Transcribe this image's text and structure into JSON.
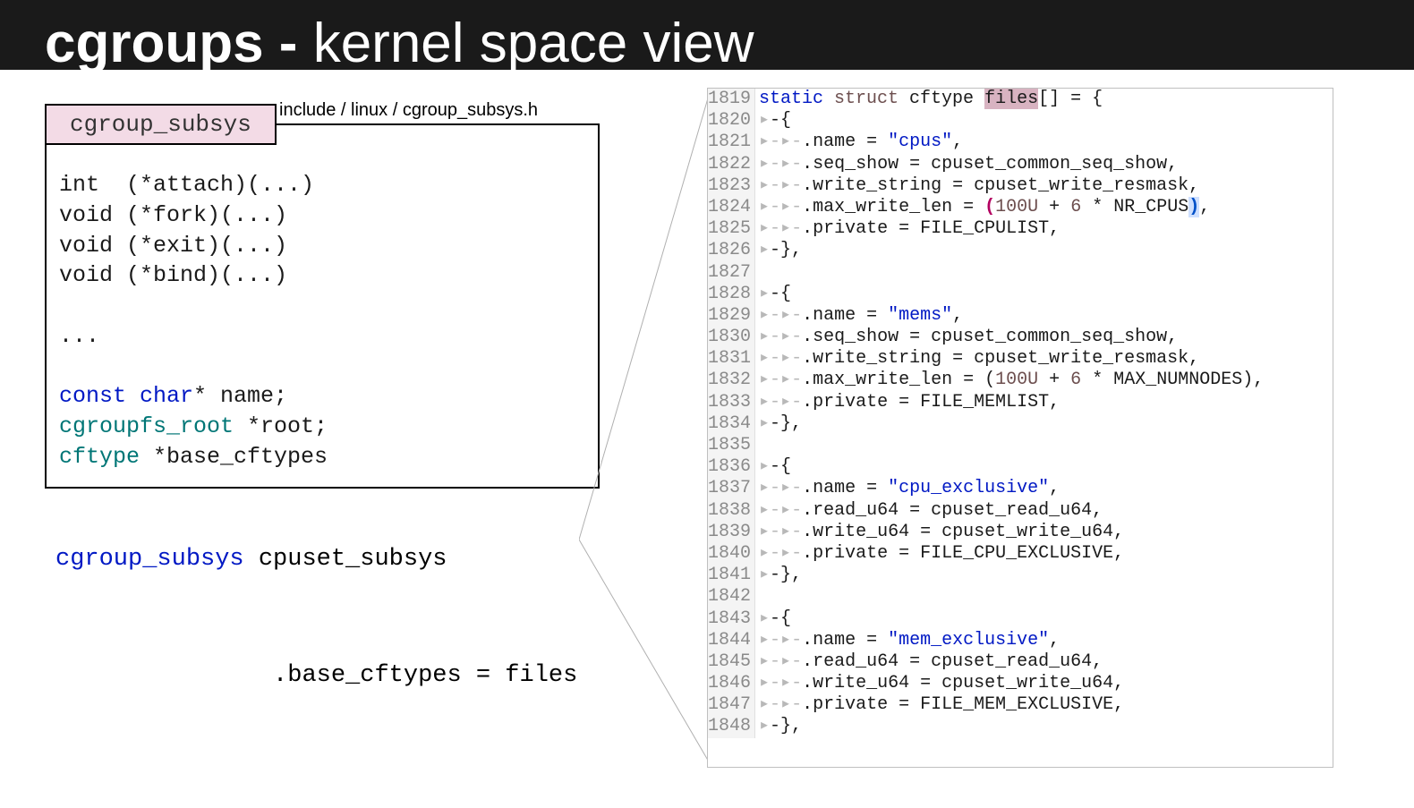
{
  "title_bold": "cgroups - ",
  "title_thin": "kernel space view",
  "header_path": "include / linux / cgroup_subsys.h",
  "tag": "cgroup_subsys",
  "struct_lines": [
    {
      "t": "plain",
      "v": "int  (*attach)(...)"
    },
    {
      "t": "plain",
      "v": "void (*fork)(...)"
    },
    {
      "t": "plain",
      "v": "void (*exit)(...)"
    },
    {
      "t": "plain",
      "v": "void (*bind)(...)"
    },
    {
      "t": "plain",
      "v": ""
    },
    {
      "t": "plain",
      "v": "..."
    },
    {
      "t": "plain",
      "v": ""
    },
    {
      "t": "decl1",
      "k": "const char",
      "v": "* name;"
    },
    {
      "t": "decl2",
      "k": "cgroupfs_root",
      "v": " *root;"
    },
    {
      "t": "decl2",
      "k": "cftype",
      "v": " *base_cftypes"
    }
  ],
  "below": {
    "type": "cgroup_subsys",
    "name": "cpuset_subsys",
    "assign": ".base_cftypes = files"
  },
  "code": [
    {
      "n": 1819,
      "segs": [
        {
          "c": "c-blue",
          "v": "static"
        },
        {
          "v": " "
        },
        {
          "c": "c-brown",
          "v": "struct"
        },
        {
          "v": " cftype "
        },
        {
          "c": "c-hl",
          "v": "files"
        },
        {
          "v": "[] = {"
        }
      ]
    },
    {
      "n": 1820,
      "segs": [
        {
          "c": "ws",
          "v": "▸"
        },
        {
          "v": "-{"
        }
      ]
    },
    {
      "n": 1821,
      "segs": [
        {
          "c": "ws",
          "v": "▸-▸-"
        },
        {
          "v": ".name = "
        },
        {
          "c": "c-str",
          "v": "\"cpus\""
        },
        {
          "v": ","
        }
      ]
    },
    {
      "n": 1822,
      "segs": [
        {
          "c": "ws",
          "v": "▸-▸-"
        },
        {
          "v": ".seq_show = cpuset_common_seq_show,"
        }
      ]
    },
    {
      "n": 1823,
      "segs": [
        {
          "c": "ws",
          "v": "▸-▸-"
        },
        {
          "v": ".write_string = cpuset_write_resmask,"
        }
      ]
    },
    {
      "n": 1824,
      "segs": [
        {
          "c": "ws",
          "v": "▸-▸-"
        },
        {
          "v": ".max_write_len = "
        },
        {
          "c": "c-pp",
          "v": "("
        },
        {
          "c": "c-num",
          "v": "100U"
        },
        {
          "v": " + "
        },
        {
          "c": "c-num",
          "v": "6"
        },
        {
          "v": " * NR_CPUS"
        },
        {
          "c": "c-pb",
          "v": ")"
        },
        {
          "v": ","
        }
      ]
    },
    {
      "n": 1825,
      "segs": [
        {
          "c": "ws",
          "v": "▸-▸-"
        },
        {
          "v": ".private = FILE_CPULIST,"
        }
      ]
    },
    {
      "n": 1826,
      "segs": [
        {
          "c": "ws",
          "v": "▸"
        },
        {
          "v": "-},"
        }
      ]
    },
    {
      "n": 1827,
      "segs": [
        {
          "v": ""
        }
      ]
    },
    {
      "n": 1828,
      "segs": [
        {
          "c": "ws",
          "v": "▸"
        },
        {
          "v": "-{"
        }
      ]
    },
    {
      "n": 1829,
      "segs": [
        {
          "c": "ws",
          "v": "▸-▸-"
        },
        {
          "v": ".name = "
        },
        {
          "c": "c-str",
          "v": "\"mems\""
        },
        {
          "v": ","
        }
      ]
    },
    {
      "n": 1830,
      "segs": [
        {
          "c": "ws",
          "v": "▸-▸-"
        },
        {
          "v": ".seq_show = cpuset_common_seq_show,"
        }
      ]
    },
    {
      "n": 1831,
      "segs": [
        {
          "c": "ws",
          "v": "▸-▸-"
        },
        {
          "v": ".write_string = cpuset_write_resmask,"
        }
      ]
    },
    {
      "n": 1832,
      "segs": [
        {
          "c": "ws",
          "v": "▸-▸-"
        },
        {
          "v": ".max_write_len = ("
        },
        {
          "c": "c-num",
          "v": "100U"
        },
        {
          "v": " + "
        },
        {
          "c": "c-num",
          "v": "6"
        },
        {
          "v": " * MAX_NUMNODES),"
        }
      ]
    },
    {
      "n": 1833,
      "segs": [
        {
          "c": "ws",
          "v": "▸-▸-"
        },
        {
          "v": ".private = FILE_MEMLIST,"
        }
      ]
    },
    {
      "n": 1834,
      "segs": [
        {
          "c": "ws",
          "v": "▸"
        },
        {
          "v": "-},"
        }
      ]
    },
    {
      "n": 1835,
      "segs": [
        {
          "v": ""
        }
      ]
    },
    {
      "n": 1836,
      "segs": [
        {
          "c": "ws",
          "v": "▸"
        },
        {
          "v": "-{"
        }
      ]
    },
    {
      "n": 1837,
      "segs": [
        {
          "c": "ws",
          "v": "▸-▸-"
        },
        {
          "v": ".name = "
        },
        {
          "c": "c-str",
          "v": "\"cpu_exclusive\""
        },
        {
          "v": ","
        }
      ]
    },
    {
      "n": 1838,
      "segs": [
        {
          "c": "ws",
          "v": "▸-▸-"
        },
        {
          "v": ".read_u64 = cpuset_read_u64,"
        }
      ]
    },
    {
      "n": 1839,
      "segs": [
        {
          "c": "ws",
          "v": "▸-▸-"
        },
        {
          "v": ".write_u64 = cpuset_write_u64,"
        }
      ]
    },
    {
      "n": 1840,
      "segs": [
        {
          "c": "ws",
          "v": "▸-▸-"
        },
        {
          "v": ".private = FILE_CPU_EXCLUSIVE,"
        }
      ]
    },
    {
      "n": 1841,
      "segs": [
        {
          "c": "ws",
          "v": "▸"
        },
        {
          "v": "-},"
        }
      ]
    },
    {
      "n": 1842,
      "segs": [
        {
          "v": ""
        }
      ]
    },
    {
      "n": 1843,
      "segs": [
        {
          "c": "ws",
          "v": "▸"
        },
        {
          "v": "-{"
        }
      ]
    },
    {
      "n": 1844,
      "segs": [
        {
          "c": "ws",
          "v": "▸-▸-"
        },
        {
          "v": ".name = "
        },
        {
          "c": "c-str",
          "v": "\"mem_exclusive\""
        },
        {
          "v": ","
        }
      ]
    },
    {
      "n": 1845,
      "segs": [
        {
          "c": "ws",
          "v": "▸-▸-"
        },
        {
          "v": ".read_u64 = cpuset_read_u64,"
        }
      ]
    },
    {
      "n": 1846,
      "segs": [
        {
          "c": "ws",
          "v": "▸-▸-"
        },
        {
          "v": ".write_u64 = cpuset_write_u64,"
        }
      ]
    },
    {
      "n": 1847,
      "segs": [
        {
          "c": "ws",
          "v": "▸-▸-"
        },
        {
          "v": ".private = FILE_MEM_EXCLUSIVE,"
        }
      ]
    },
    {
      "n": 1848,
      "segs": [
        {
          "c": "ws",
          "v": "▸"
        },
        {
          "v": "-},"
        }
      ]
    }
  ]
}
